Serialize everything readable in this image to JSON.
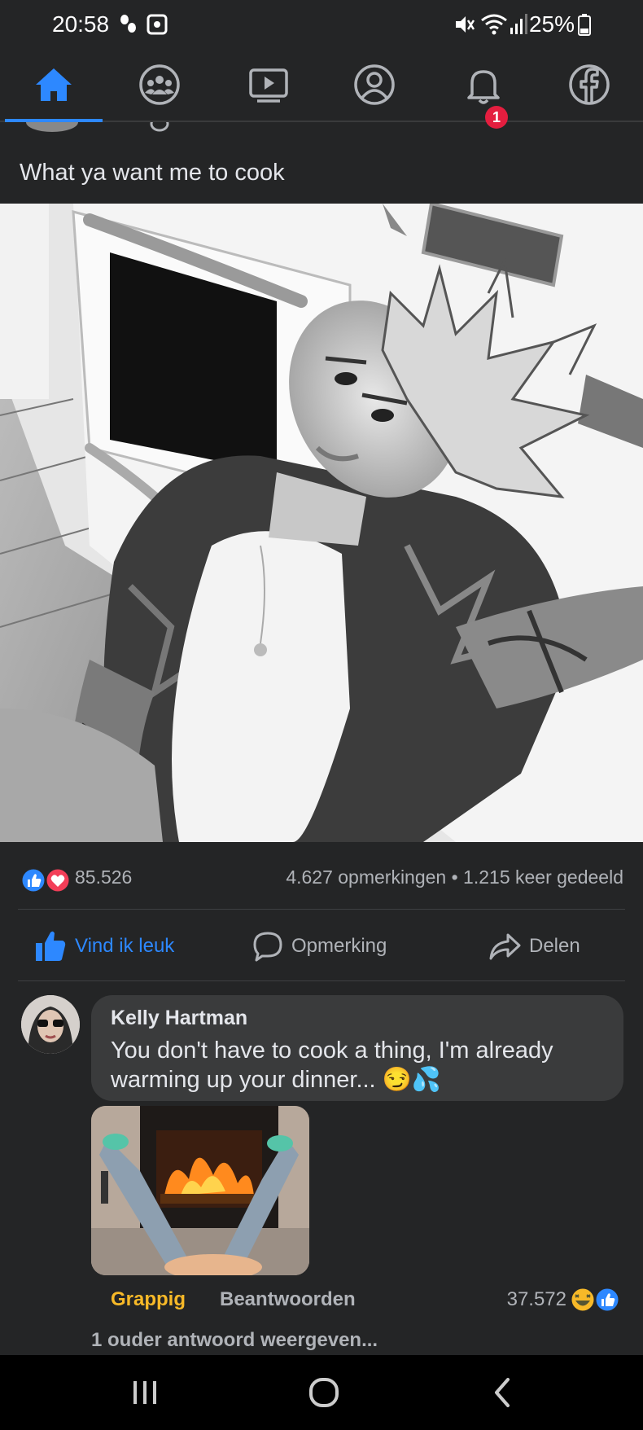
{
  "status_bar": {
    "time": "20:58",
    "battery": "25%",
    "left_icons": [
      "steps-icon",
      "app-notification-icon"
    ],
    "right_icons": [
      "mute-icon",
      "wifi-icon",
      "signal-icon",
      "battery-icon"
    ]
  },
  "nav": {
    "tabs": [
      {
        "name": "home",
        "icon": "home-icon",
        "active": true
      },
      {
        "name": "groups",
        "icon": "groups-icon",
        "active": false
      },
      {
        "name": "watch",
        "icon": "video-icon",
        "active": false
      },
      {
        "name": "profile",
        "icon": "profile-icon",
        "active": false
      },
      {
        "name": "notifications",
        "icon": "bell-icon",
        "active": false
      },
      {
        "name": "facebook-menu",
        "icon": "facebook-icon",
        "active": false
      }
    ],
    "notification_badge": "1",
    "accent": "#2d88ff"
  },
  "post": {
    "caption": "What ya want me to cook",
    "reaction_count": "85.526",
    "stats": "4.627 opmerkingen • 1.215 keer gedeeld",
    "actions": {
      "like": "Vind ik leuk",
      "comment": "Opmerking",
      "share": "Delen"
    }
  },
  "comment": {
    "author": "Kelly Hartman",
    "text": "You don't have to cook a thing, I'm already warming up your dinner... 😏💦",
    "reaction_label": "Grappig",
    "reply_label": "Beantwoorden",
    "reaction_count": "37.572",
    "view_replies": "1 ouder antwoord weergeven..."
  },
  "colors": {
    "background": "#242526",
    "bubble": "#3a3b3c",
    "funny": "#f7b928",
    "like_blue": "#2d88ff",
    "love_red": "#f33e58"
  }
}
